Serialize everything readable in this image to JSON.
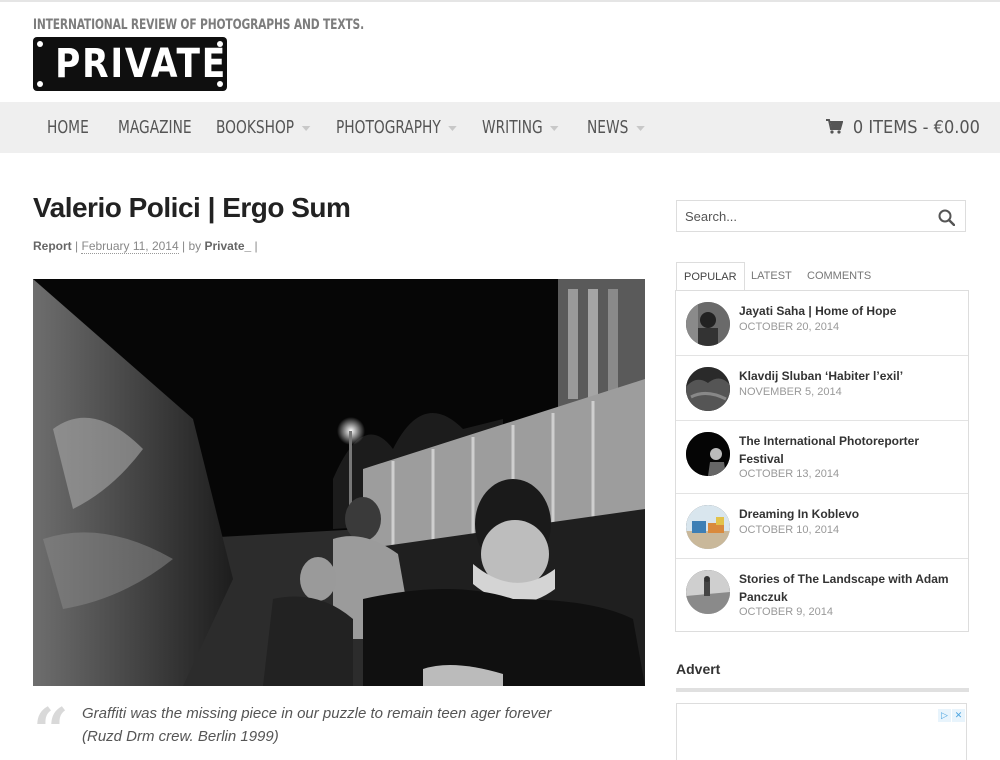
{
  "site": {
    "tagline": "INTERNATIONAL REVIEW OF PHOTOGRAPHS AND TEXTS.",
    "logo_text": "PRIVATE"
  },
  "nav": {
    "items": [
      {
        "label": "HOME",
        "has_dropdown": false
      },
      {
        "label": "MAGAZINE",
        "has_dropdown": false
      },
      {
        "label": "BOOKSHOP",
        "has_dropdown": true
      },
      {
        "label": "PHOTOGRAPHY",
        "has_dropdown": true
      },
      {
        "label": "WRITING",
        "has_dropdown": true
      },
      {
        "label": "NEWS",
        "has_dropdown": true
      }
    ],
    "cart_icon": "cart-icon",
    "cart_label": "0 ITEMS - €0.00"
  },
  "post": {
    "title": "Valerio Polici | Ergo Sum",
    "category": "Report",
    "sep1": "|",
    "date": "February 11, 2014",
    "sep2": "|",
    "by_label": "by",
    "author": "Private_",
    "sep3": "|",
    "quote_mark": "“",
    "quote_line1": "Graffiti was the missing piece in our puzzle to remain teen ager forever",
    "quote_line2": "(Ruzd Drm crew. Berlin 1999)"
  },
  "sidebar": {
    "search_placeholder": "Search...",
    "search_icon": "search-icon",
    "tabs": [
      {
        "label": "POPULAR",
        "active": true
      },
      {
        "label": "LATEST",
        "active": false
      },
      {
        "label": "COMMENTS",
        "active": false
      }
    ],
    "popular": [
      {
        "title": "Jayati Saha | Home of Hope",
        "date": "OCTOBER 20, 2014"
      },
      {
        "title": "Klavdij Sluban ‘Habiter l’exil’",
        "date": "NOVEMBER 5, 2014"
      },
      {
        "title": "The International Photoreporter Festival",
        "date": "OCTOBER 13, 2014"
      },
      {
        "title": "Dreaming In Koblevo",
        "date": "OCTOBER 10, 2014"
      },
      {
        "title": "Stories of The Landscape with Adam Panczuk",
        "date": "OCTOBER 9, 2014"
      }
    ],
    "advert_heading": "Advert",
    "ad_icons": [
      "▷",
      "✕"
    ]
  }
}
